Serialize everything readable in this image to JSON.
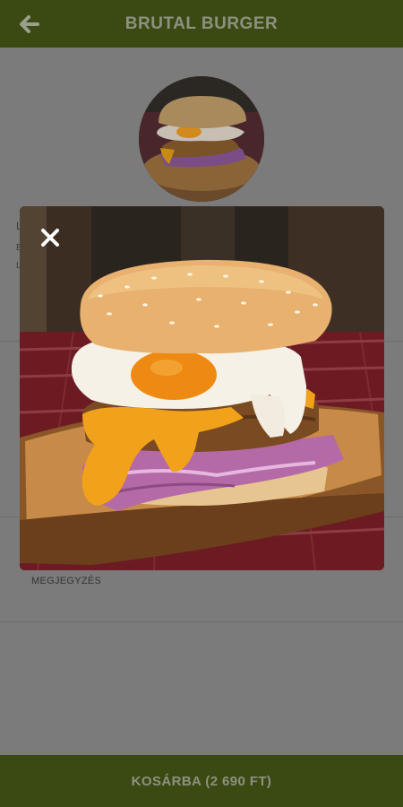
{
  "header": {
    "title": "BRUTAL BURGER",
    "back_icon": "arrow-left-icon"
  },
  "page": {
    "partial_texts": [
      "L",
      "B",
      "L"
    ],
    "comment_label": "MEGJEGYZÉS"
  },
  "modal": {
    "close_icon": "close-icon",
    "image_subject": "burger with fried egg, cheese and purple coleslaw on wooden plate"
  },
  "footer": {
    "cart_button_label": "KOSÁRBA (2 690 FT)"
  },
  "colors": {
    "header_bg": "#3a4a12",
    "footer_bg": "#3a4a12",
    "header_text": "#8c9180",
    "overlay_bg": "#7b7b7b"
  }
}
